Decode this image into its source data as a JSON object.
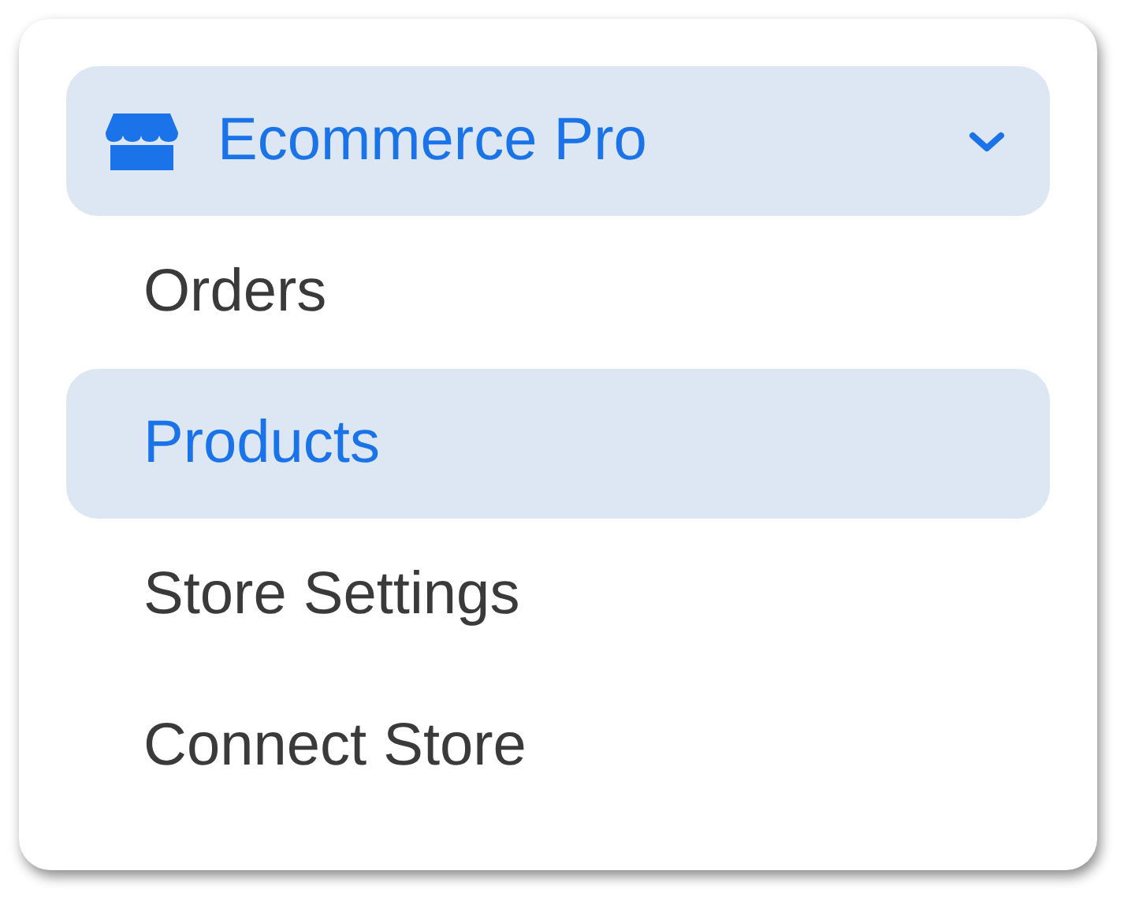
{
  "menu": {
    "title": "Ecommerce Pro",
    "expanded": true,
    "items": [
      {
        "label": "Orders",
        "selected": false
      },
      {
        "label": "Products",
        "selected": true
      },
      {
        "label": "Store Settings",
        "selected": false
      },
      {
        "label": "Connect Store",
        "selected": false
      }
    ]
  }
}
